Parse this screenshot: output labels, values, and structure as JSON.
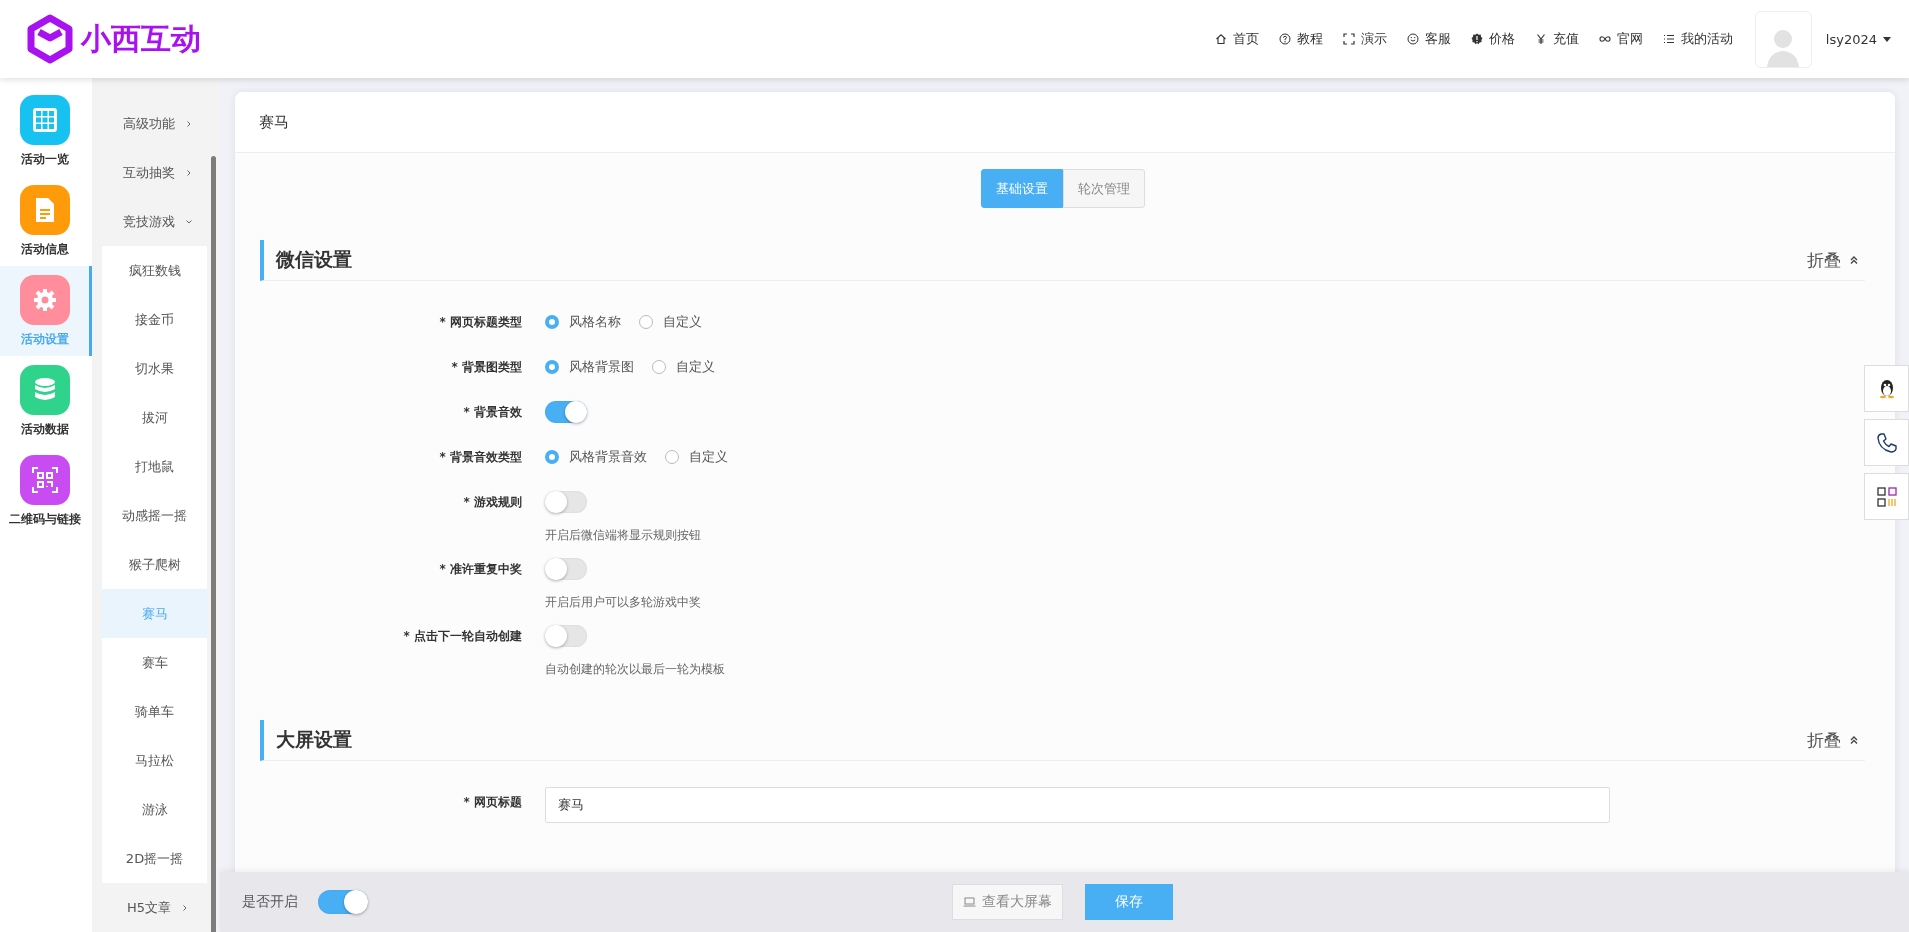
{
  "header": {
    "logo_text": "小西互动",
    "nav": [
      {
        "label": "首页"
      },
      {
        "label": "教程"
      },
      {
        "label": "演示"
      },
      {
        "label": "客服"
      },
      {
        "label": "价格"
      },
      {
        "label": "充值"
      },
      {
        "label": "官网"
      },
      {
        "label": "我的活动"
      }
    ],
    "username": "lsy2024"
  },
  "main_nav": [
    {
      "label": "活动一览",
      "color": "#17c2f0",
      "selected": false
    },
    {
      "label": "活动信息",
      "color": "#ff9a0a",
      "selected": false
    },
    {
      "label": "活动设置",
      "color": "#ff8d9b",
      "selected": true
    },
    {
      "label": "活动数据",
      "color": "#2fd38b",
      "selected": false
    },
    {
      "label": "二维码与链接",
      "color": "#c84cf2",
      "selected": false
    }
  ],
  "sub_nav": [
    {
      "label": "高级功能",
      "expanded": false
    },
    {
      "label": "互动抽奖",
      "expanded": false
    },
    {
      "label": "竞技游戏",
      "expanded": true,
      "children": [
        {
          "label": "疯狂数钱",
          "selected": false
        },
        {
          "label": "接金币",
          "selected": false
        },
        {
          "label": "切水果",
          "selected": false
        },
        {
          "label": "拔河",
          "selected": false
        },
        {
          "label": "打地鼠",
          "selected": false
        },
        {
          "label": "动感摇一摇",
          "selected": false
        },
        {
          "label": "猴子爬树",
          "selected": false
        },
        {
          "label": "赛马",
          "selected": true
        },
        {
          "label": "赛车",
          "selected": false
        },
        {
          "label": "骑单车",
          "selected": false
        },
        {
          "label": "马拉松",
          "selected": false
        },
        {
          "label": "游泳",
          "selected": false
        },
        {
          "label": "2D摇一摇",
          "selected": false
        }
      ]
    },
    {
      "label": "H5文章",
      "expanded": false
    }
  ],
  "card": {
    "title": "赛马",
    "tabs": [
      {
        "label": "基础设置",
        "selected": true
      },
      {
        "label": "轮次管理",
        "selected": false
      }
    ],
    "sections": [
      {
        "title": "微信设置",
        "collapse_label": "折叠",
        "fields": [
          {
            "kind": "radio",
            "label": "* 网页标题类型",
            "options": [
              {
                "label": "风格名称",
                "selected": true
              },
              {
                "label": "自定义",
                "selected": false
              }
            ]
          },
          {
            "kind": "radio",
            "label": "* 背景图类型",
            "options": [
              {
                "label": "风格背景图",
                "selected": true
              },
              {
                "label": "自定义",
                "selected": false
              }
            ]
          },
          {
            "kind": "switch",
            "label": "* 背景音效",
            "on": true
          },
          {
            "kind": "radio",
            "label": "* 背景音效类型",
            "options": [
              {
                "label": "风格背景音效",
                "selected": true
              },
              {
                "label": "自定义",
                "selected": false
              }
            ]
          },
          {
            "kind": "switch",
            "label": "* 游戏规则",
            "on": false,
            "hint": "开启后微信端将显示规则按钮"
          },
          {
            "kind": "switch",
            "label": "* 准许重复中奖",
            "on": false,
            "hint": "开启后用户可以多轮游戏中奖"
          },
          {
            "kind": "switch",
            "label": "* 点击下一轮自动创建",
            "on": false,
            "hint": "自动创建的轮次以最后一轮为模板"
          }
        ]
      },
      {
        "title": "大屏设置",
        "collapse_label": "折叠",
        "fields": [
          {
            "kind": "input",
            "label": "* 网页标题",
            "value": "赛马"
          }
        ]
      }
    ]
  },
  "footer": {
    "label": "是否开启",
    "on": true,
    "preview_button": "查看大屏幕",
    "save_button": "保存"
  }
}
